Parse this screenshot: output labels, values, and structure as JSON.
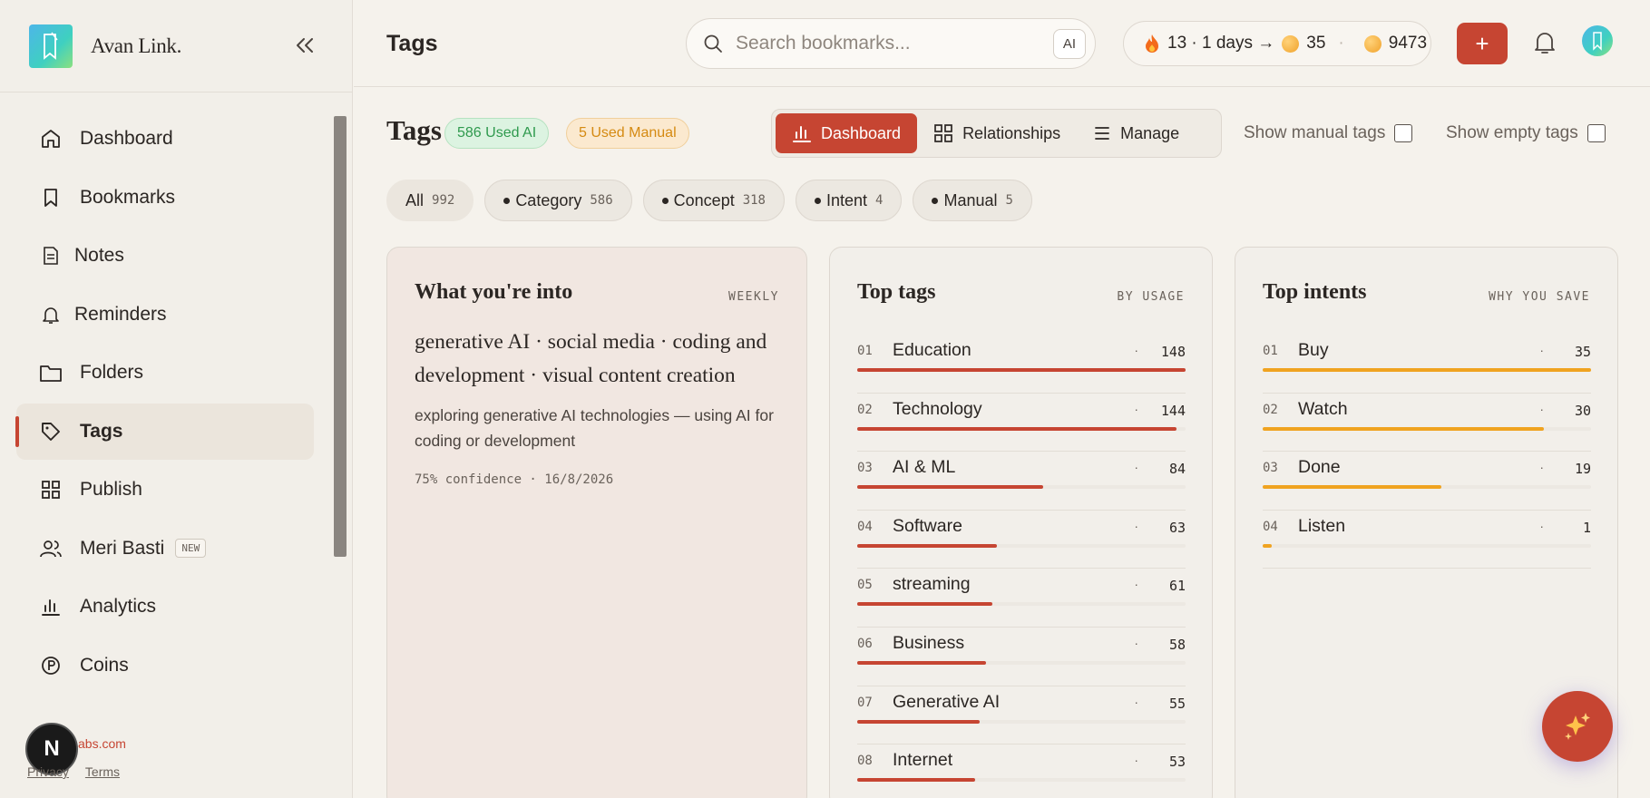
{
  "brand": {
    "name": "Avan Link."
  },
  "sidebar": {
    "items": [
      {
        "label": "Dashboard",
        "icon": "home-icon"
      },
      {
        "label": "Bookmarks",
        "icon": "bookmark-icon"
      },
      {
        "label": "Notes",
        "icon": "note-icon"
      },
      {
        "label": "Reminders",
        "icon": "bell-icon"
      },
      {
        "label": "Folders",
        "icon": "folder-icon"
      },
      {
        "label": "Tags",
        "icon": "tag-icon",
        "active": true
      },
      {
        "label": "Publish",
        "icon": "grid-icon"
      },
      {
        "label": "Meri Basti",
        "icon": "users-icon",
        "badge": "NEW"
      },
      {
        "label": "Analytics",
        "icon": "bar-chart-icon"
      },
      {
        "label": "Coins",
        "icon": "coin-icon"
      }
    ],
    "footer": {
      "domain": "abs.com",
      "privacy": "Privacy",
      "terms": "Terms",
      "dev_badge": "N"
    }
  },
  "header": {
    "title": "Tags",
    "search": {
      "placeholder": "Search bookmarks...",
      "ai_label": "AI"
    },
    "streak": {
      "text": "13 · 1 days →",
      "streak_coins": "35",
      "coins": "9473"
    },
    "add_label": "+"
  },
  "tags_header": {
    "title": "Tags",
    "used_ai": "586 Used AI",
    "used_manual": "5 Used Manual",
    "views": [
      {
        "label": "Dashboard",
        "icon": "bar-chart-icon",
        "active": true
      },
      {
        "label": "Relationships",
        "icon": "grid-icon"
      },
      {
        "label": "Manage",
        "icon": "list-icon"
      }
    ],
    "show_manual": "Show manual tags",
    "show_empty": "Show empty tags"
  },
  "filters": [
    {
      "label": "All",
      "count": "992"
    },
    {
      "label": "Category",
      "count": "586"
    },
    {
      "label": "Concept",
      "count": "318"
    },
    {
      "label": "Intent",
      "count": "4"
    },
    {
      "label": "Manual",
      "count": "5"
    }
  ],
  "into": {
    "title": "What you're into",
    "kicker": "WEEKLY",
    "headline": "generative AI · social media · coding and development · visual content creation",
    "description": "exploring generative AI technologies — using AI for coding or development",
    "meta": "75% confidence · 16/8/2026"
  },
  "top_tags": {
    "title": "Top tags",
    "kicker": "BY USAGE",
    "bar_color": "#c64532",
    "max": 148,
    "items": [
      {
        "rank": "01",
        "name": "Education",
        "value": 148
      },
      {
        "rank": "02",
        "name": "Technology",
        "value": 144
      },
      {
        "rank": "03",
        "name": "AI & ML",
        "value": 84
      },
      {
        "rank": "04",
        "name": "Software",
        "value": 63
      },
      {
        "rank": "05",
        "name": "streaming",
        "value": 61
      },
      {
        "rank": "06",
        "name": "Business",
        "value": 58
      },
      {
        "rank": "07",
        "name": "Generative AI",
        "value": 55
      },
      {
        "rank": "08",
        "name": "Internet",
        "value": 53
      }
    ]
  },
  "top_intents": {
    "title": "Top intents",
    "kicker": "WHY YOU SAVE",
    "bar_color": "#f0a320",
    "max": 35,
    "items": [
      {
        "rank": "01",
        "name": "Buy",
        "value": 35
      },
      {
        "rank": "02",
        "name": "Watch",
        "value": 30
      },
      {
        "rank": "03",
        "name": "Done",
        "value": 19
      },
      {
        "rank": "04",
        "name": "Listen",
        "value": 1
      }
    ]
  }
}
